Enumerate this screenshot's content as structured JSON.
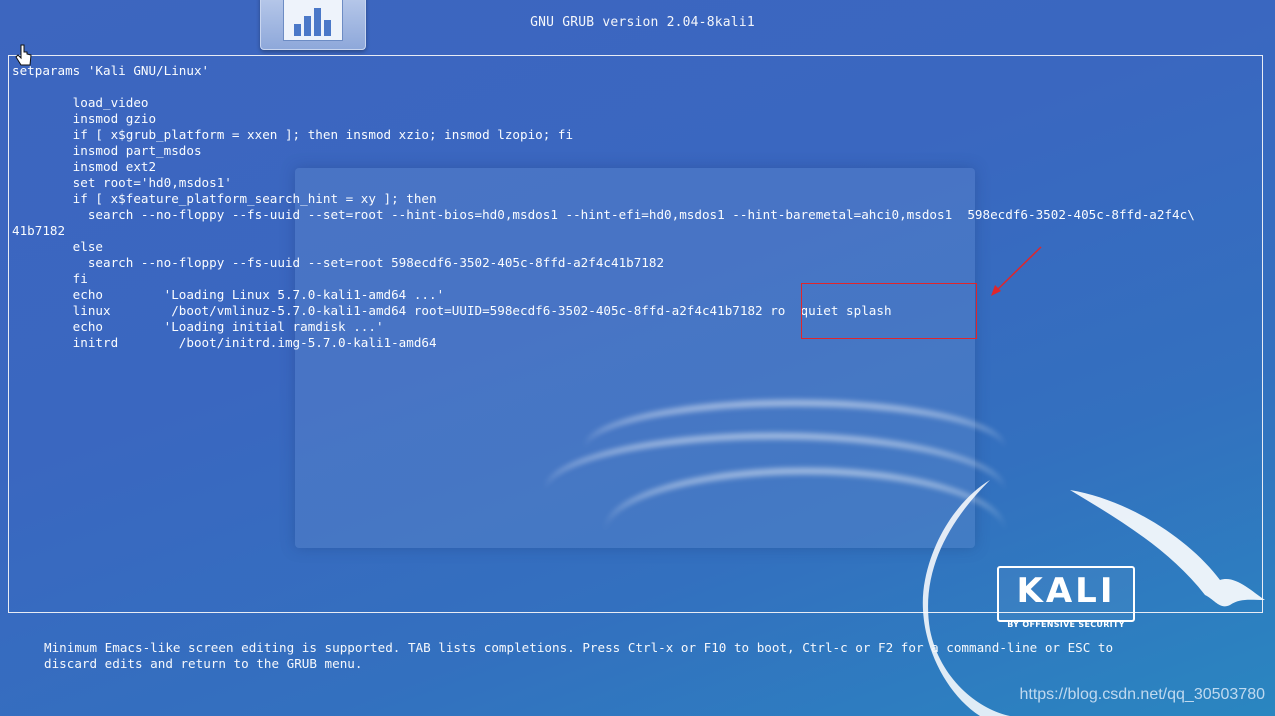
{
  "header": {
    "title": "GNU GRUB  version 2.04-8kali1"
  },
  "editor": {
    "lines": [
      "setparams 'Kali GNU/Linux'",
      "",
      "        load_video",
      "        insmod gzio",
      "        if [ x$grub_platform = xxen ]; then insmod xzio; insmod lzopio; fi",
      "        insmod part_msdos",
      "        insmod ext2",
      "        set root='hd0,msdos1'",
      "        if [ x$feature_platform_search_hint = xy ]; then",
      "          search --no-floppy --fs-uuid --set=root --hint-bios=hd0,msdos1 --hint-efi=hd0,msdos1 --hint-baremetal=ahci0,msdos1  598ecdf6-3502-405c-8ffd-a2f4c\\",
      "41b7182",
      "        else",
      "          search --no-floppy --fs-uuid --set=root 598ecdf6-3502-405c-8ffd-a2f4c41b7182",
      "        fi",
      "        echo        'Loading Linux 5.7.0-kali1-amd64 ...'",
      "        linux        /boot/vmlinuz-5.7.0-kali1-amd64 root=UUID=598ecdf6-3502-405c-8ffd-a2f4c41b7182 ro  quiet splash",
      "        echo        'Loading initial ramdisk ...'",
      "        initrd        /boot/initrd.img-5.7.0-kali1-amd64"
    ]
  },
  "footer": {
    "help_text": "Minimum Emacs-like screen editing is supported. TAB lists completions. Press Ctrl-x or F10 to boot, Ctrl-c or F2 for a command-line or ESC to\ndiscard edits and return to the GRUB menu."
  },
  "logo": {
    "word": "KALI",
    "tagline": "BY OFFENSIVE SECURITY"
  },
  "watermark": "https://blog.csdn.net/qq_30503780",
  "icons": {
    "cursor": "hand-cursor-icon",
    "taskbar_app": "chart-document-icon",
    "annotation": "red-arrow-icon"
  },
  "colors": {
    "annotation": "#e0262b",
    "background": "#3d66bf"
  }
}
